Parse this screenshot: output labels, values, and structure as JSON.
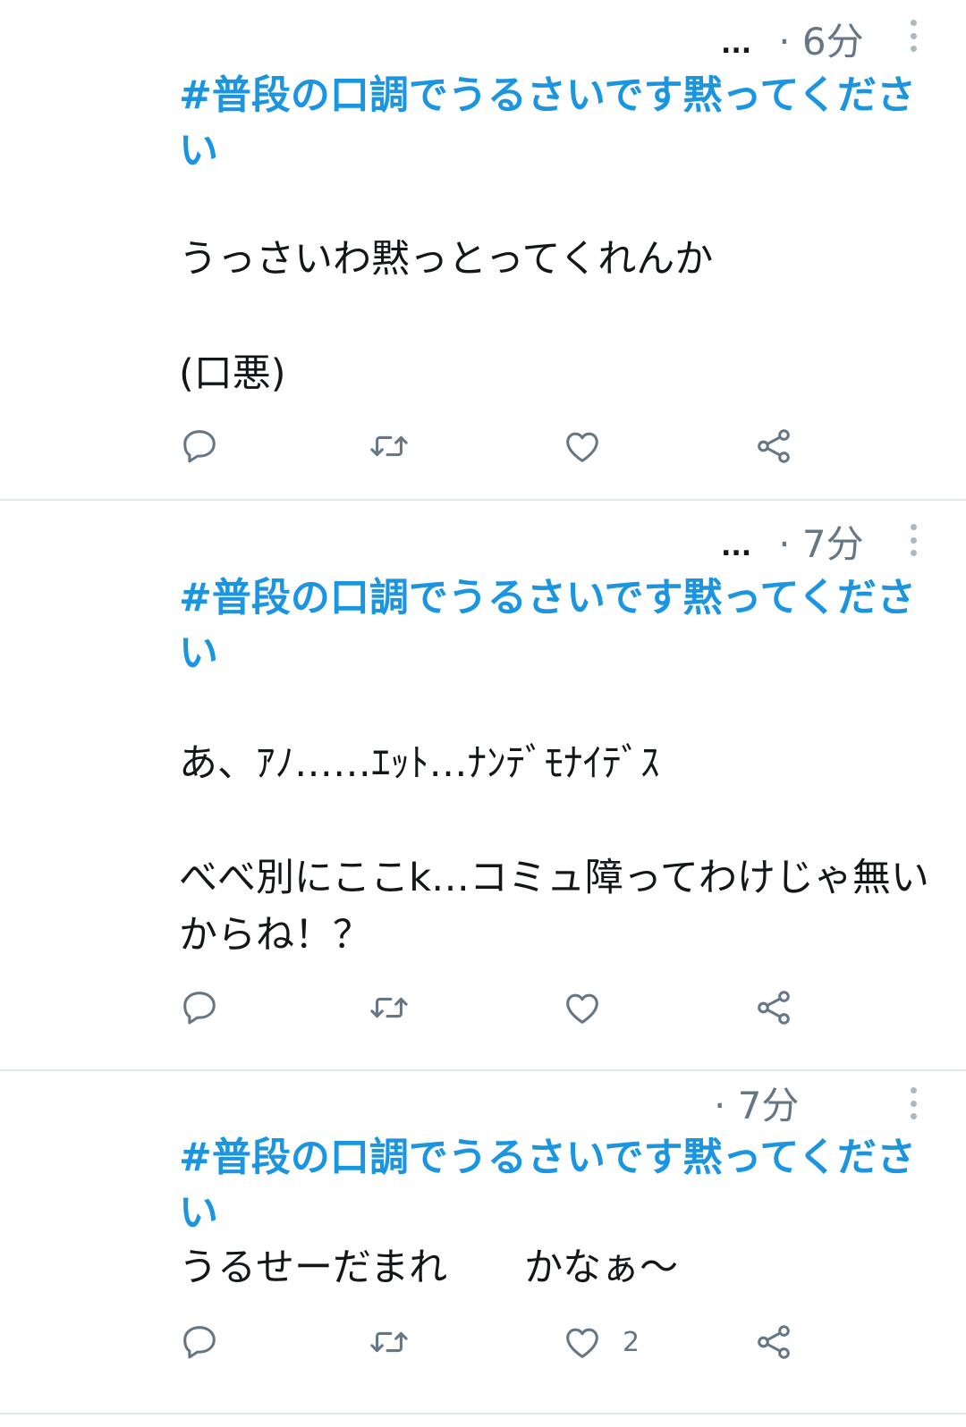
{
  "tweets": [
    {
      "ellipsis": "...",
      "time": "· 6分",
      "hashtag": "#普段の口調でうるさいです黙ってください",
      "body": "うっさいわ黙っとってくれんか\n\n(口悪)",
      "like_count": ""
    },
    {
      "ellipsis": "...",
      "time": "· 7分",
      "hashtag": "#普段の口調でうるさいです黙ってください",
      "body": "あ、ｱﾉ……ｴｯﾄ…ﾅﾝﾃﾞﾓﾅｲﾃﾞｽ\n\nべべ別にここk…コミュ障ってわけじゃ無いからね！？",
      "like_count": ""
    },
    {
      "ellipsis": "",
      "time": "· 7分",
      "hashtag": "#普段の口調でうるさいです黙ってください",
      "body": "うるせーだまれ　　かなぁ〜",
      "like_count": "2"
    }
  ],
  "icons": {
    "reply": "reply-icon",
    "retweet": "retweet-icon",
    "like": "heart-icon",
    "share": "share-icon",
    "more": "more-vertical-icon"
  },
  "colors": {
    "hashtag": "#1b95e0",
    "icon": "#657786",
    "divider": "#e1e8ed"
  }
}
